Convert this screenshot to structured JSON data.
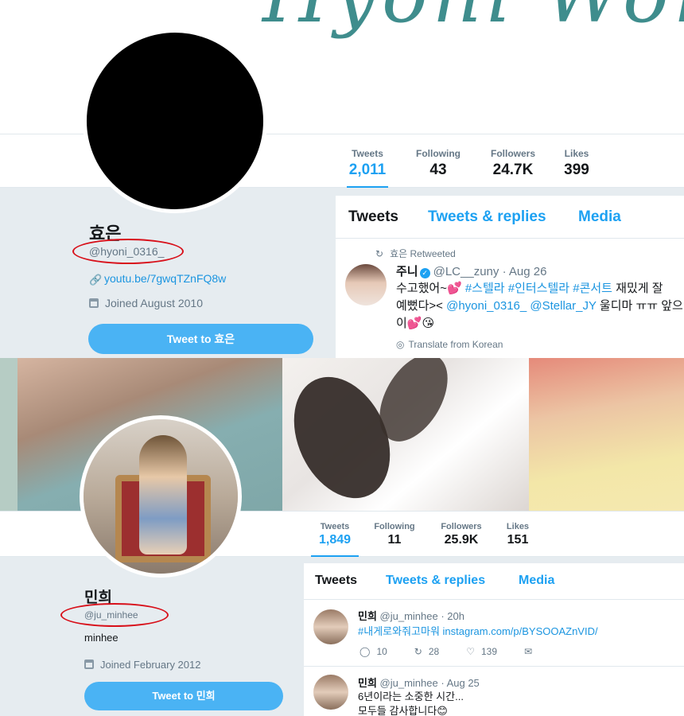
{
  "profile1": {
    "banner_text": "Hyoni Wor",
    "name": "효은",
    "handle": "@hyoni_0316_",
    "link": "youtu.be/7gwqTZnFQ8w",
    "joined": "Joined August 2010",
    "tweet_to": "Tweet to 효은",
    "stats": [
      {
        "label": "Tweets",
        "value": "2,011"
      },
      {
        "label": "Following",
        "value": "43"
      },
      {
        "label": "Followers",
        "value": "24.7K"
      },
      {
        "label": "Likes",
        "value": "399"
      }
    ],
    "tabs": [
      "Tweets",
      "Tweets & replies",
      "Media"
    ],
    "tweet": {
      "retweet_label": "효은 Retweeted",
      "name": "주니",
      "handle": "@LC__zuny",
      "date": "· Aug 26",
      "line1_a": "수고했어~💕 ",
      "line1_tags": "#스텔라 #인터스텔라 #콘서트",
      "line1_b": " 재밌게 잘",
      "line2_a": "예뻤다>< ",
      "line2_mentions": "@hyoni_0316_ @Stellar_JY",
      "line2_b": " 울디마 ㅠㅠ 앞으",
      "line3": "이💕😘",
      "translate": "Translate from Korean"
    }
  },
  "profile2": {
    "name": "민희",
    "handle": "@ju_minhee",
    "bio": "minhee",
    "joined": "Joined February 2012",
    "tweet_to": "Tweet to 민희",
    "stats": [
      {
        "label": "Tweets",
        "value": "1,849"
      },
      {
        "label": "Following",
        "value": "11"
      },
      {
        "label": "Followers",
        "value": "25.9K"
      },
      {
        "label": "Likes",
        "value": "151"
      }
    ],
    "tabs": [
      "Tweets",
      "Tweets & replies",
      "Media"
    ],
    "tweets": [
      {
        "name": "민희",
        "handle": "@ju_minhee",
        "date": "· 20h",
        "text": "#내게로와줘고마워 instagram.com/p/BYSOOAZnVID/",
        "replies": "10",
        "retweets": "28",
        "likes": "139"
      },
      {
        "name": "민희",
        "handle": "@ju_minhee",
        "date": "· Aug 25",
        "text1": "6년이라는 소중한 시간...",
        "text2": "모두들 감사합니다😊"
      }
    ]
  },
  "colors": {
    "accent": "#1da1f2",
    "annotation": "#d8101a",
    "button": "#4ab3f4"
  }
}
